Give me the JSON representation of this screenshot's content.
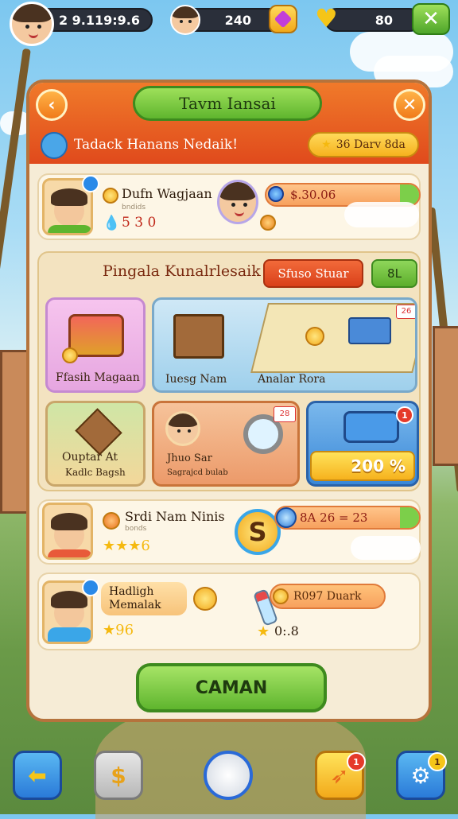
{
  "hud": {
    "player_id": "2 9.1𝟭9:9.6",
    "currency_1": "240",
    "currency_2": "80",
    "colors": {
      "accent_orange": "#f07a2a",
      "accent_green": "#5fb52e",
      "hud_dark": "#2a2f3a"
    }
  },
  "panel": {
    "title": "Tavm Iansai",
    "subtitle": "Tadack Hanans Nedaik!",
    "reward": "36 Darv 8da",
    "back_icon": "back-arrow-icon",
    "close_icon": "close-icon"
  },
  "rows": [
    {
      "name": "Dufn Wagjaan",
      "detail": "bndids",
      "value": "5 3 0",
      "amount": "$.30.06"
    },
    {
      "name": "Srdi Nam Ninis",
      "detail": "bonds",
      "stars": "★★★6",
      "amount": "8A 26 = 23"
    },
    {
      "name": "Hadligh Memalak",
      "stars": "★96",
      "pill": "R097 Duark",
      "small_value": "0:.8"
    }
  ],
  "event": {
    "title": "Pingala Kunalrlesaik",
    "red_button": "Sfuso Stuar",
    "green_button": "8L",
    "tiles": [
      {
        "label": "Ffasih Magaan"
      },
      {
        "label": "Iuesg Nam"
      },
      {
        "label": "Analar Rora",
        "badge": "26"
      },
      {
        "label": "Ouptar At",
        "sub": "Kadlc Bagsh"
      },
      {
        "label": "Jhuo Sar",
        "sub": "Sagrajcd bulab",
        "badge": "28"
      },
      {
        "label": "200 %",
        "badge": "1"
      }
    ]
  },
  "cta_label": "CAMAN",
  "bottom_bar": {
    "badge_center": "1",
    "badge_right": "1"
  }
}
